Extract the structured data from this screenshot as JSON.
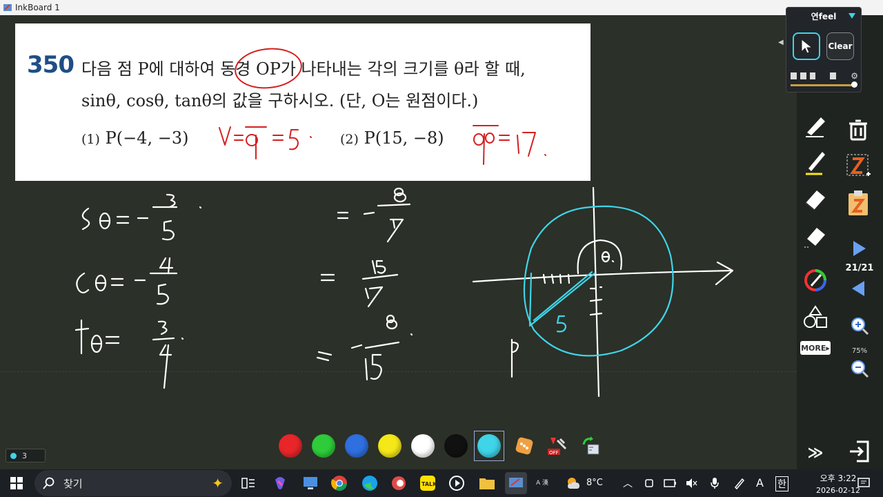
{
  "window": {
    "title": "InkBoard 1"
  },
  "problem": {
    "number": "350",
    "line1": "다음 점 P에 대하여 동경 OP가 나타내는 각의 크기를 θ라 할 때,",
    "line2": "sinθ, cosθ, tanθ의 값을 구하시오. (단, O는 원점이다.)",
    "sub1_label": "(1)",
    "sub1_point": "P(−4, −3)",
    "sub2_label": "(2)",
    "sub2_point": "P(15, −8)"
  },
  "colors": {
    "board": "#2b3028",
    "ink_white": "#ffffff",
    "ink_cyan": "#3fd4e8",
    "ink_red": "#d42020",
    "problem_number": "#1f4e86"
  },
  "palette": {
    "swatches": [
      {
        "name": "red",
        "color": "#e8262a"
      },
      {
        "name": "green",
        "color": "#2ecc3a"
      },
      {
        "name": "blue",
        "color": "#2f6fe0"
      },
      {
        "name": "yellow",
        "color": "#f5e818"
      },
      {
        "name": "white",
        "color": "#ffffff"
      },
      {
        "name": "black",
        "color": "#111111"
      },
      {
        "name": "cyan",
        "color": "#3fd4e8"
      }
    ],
    "selected": "cyan",
    "extra_icons": [
      "dice-icon",
      "laser-pointer-off-icon",
      "recycle-ruler-icon"
    ]
  },
  "page_counter": {
    "value": "3"
  },
  "floating_panel": {
    "title": "연feel",
    "clear_label": "Clear"
  },
  "right_toolbar": {
    "page_indicator": "21/21",
    "zoom": "75%",
    "more_label": "MORE▸",
    "forward_label": "≫"
  },
  "taskbar": {
    "search_placeholder": "찾기",
    "weather_temp": "8°C",
    "time": "오후 3:22",
    "date": "2026-02-12",
    "ime": "한",
    "font_a": "A",
    "ime_small": "A 漢"
  }
}
